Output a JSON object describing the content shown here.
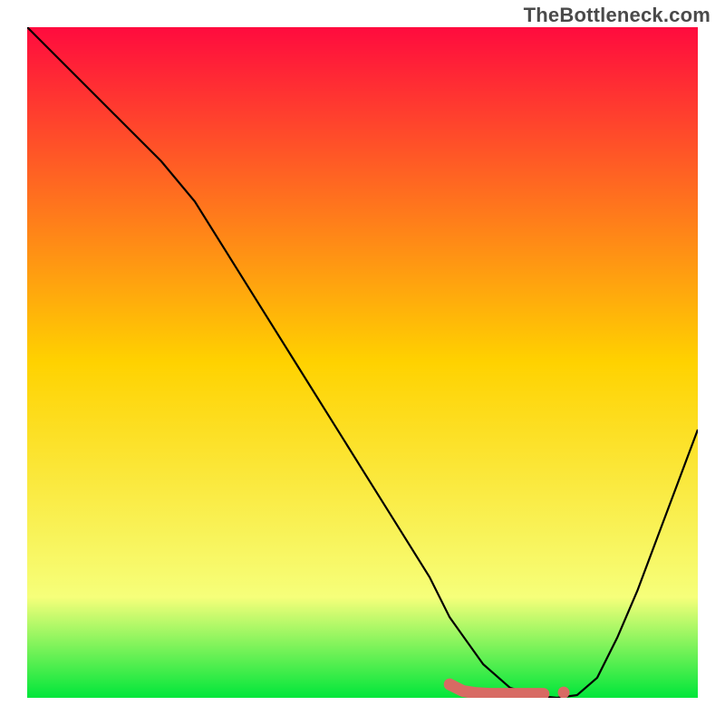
{
  "watermark": "TheBottleneck.com",
  "colors": {
    "gradient_top": "#ff0b3e",
    "gradient_mid": "#ffd200",
    "gradient_low": "#f6ff7a",
    "gradient_bottom": "#00e63a",
    "curve": "#000000",
    "marker": "#d86a63"
  },
  "chart_data": {
    "type": "line",
    "title": "",
    "xlabel": "",
    "ylabel": "",
    "xlim": [
      0,
      100
    ],
    "ylim": [
      0,
      100
    ],
    "series": [
      {
        "name": "curve",
        "x": [
          0,
          5,
          10,
          15,
          20,
          25,
          30,
          35,
          40,
          45,
          50,
          55,
          60,
          63,
          68,
          72,
          76,
          79,
          82,
          85,
          88,
          91,
          94,
          97,
          100
        ],
        "y": [
          100,
          95,
          90,
          85,
          80,
          74,
          66,
          58,
          50,
          42,
          34,
          26,
          18,
          12,
          5,
          1.5,
          0.3,
          0,
          0.4,
          3,
          9,
          16,
          24,
          32,
          40
        ]
      },
      {
        "name": "optimal-marker",
        "x": [
          63,
          65,
          67,
          69,
          71,
          73,
          75,
          77,
          80
        ],
        "y": [
          2.0,
          1.0,
          0.7,
          0.6,
          0.6,
          0.6,
          0.6,
          0.6,
          0.8
        ]
      }
    ],
    "gradient_stops": [
      {
        "offset": 0.0,
        "color": "#ff0b3e"
      },
      {
        "offset": 0.5,
        "color": "#ffd200"
      },
      {
        "offset": 0.85,
        "color": "#f6ff7a"
      },
      {
        "offset": 1.0,
        "color": "#00e63a"
      }
    ]
  }
}
